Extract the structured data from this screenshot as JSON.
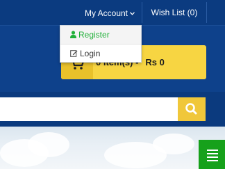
{
  "topbar": {
    "my_account_label": "My Account",
    "wishlist_label": "Wish List (0)"
  },
  "account_dropdown": {
    "items": [
      {
        "label": "Register",
        "icon": "user-icon"
      },
      {
        "label": "Login",
        "icon": "edit-icon"
      }
    ]
  },
  "cart": {
    "items_label": "0 item(s) -",
    "total_label": "Rs 0",
    "icon": "cart-icon"
  },
  "search": {
    "value": "",
    "icon": "search-icon"
  },
  "menu_button": {
    "icon": "hamburger-menu-icon"
  },
  "colors": {
    "header_blue": "#0e418b",
    "accent_yellow": "#f7d542",
    "register_green": "#22b03a",
    "menu_green": "#16a11b"
  }
}
